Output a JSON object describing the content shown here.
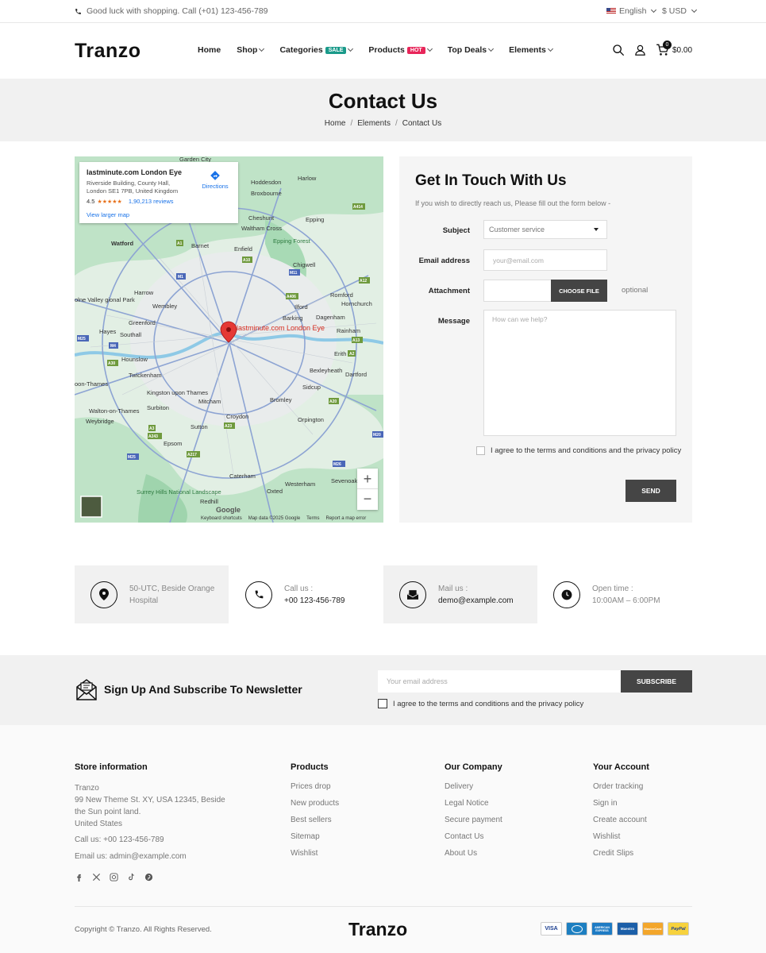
{
  "topbar": {
    "phone_text": "Good luck with shopping. Call (+01) 123-456-789",
    "language": "English",
    "currency": "$ USD"
  },
  "header": {
    "logo": "Tranzo",
    "nav": [
      {
        "label": "Home"
      },
      {
        "label": "Shop"
      },
      {
        "label": "Categories",
        "badge": "SALE",
        "badge_color": "#1a9a8a"
      },
      {
        "label": "Products",
        "badge": "HOT",
        "badge_color": "#e8265a"
      },
      {
        "label": "Top Deals"
      },
      {
        "label": "Elements"
      }
    ],
    "cart_count": "0",
    "cart_total": "$0.00"
  },
  "page": {
    "title": "Contact Us",
    "breadcrumb": [
      "Home",
      "Elements",
      "Contact Us"
    ]
  },
  "map": {
    "place_name": "lastminute.com London Eye",
    "address": "Riverside Building, County Hall, London SE1 7PB, United Kingdom",
    "rating": "4.5",
    "reviews": "1,90,213 reviews",
    "directions": "Directions",
    "larger_map": "View larger map",
    "pin_label": "lastminute.com London Eye",
    "labels": {
      "garden_city": "Garden City",
      "harlow": "Harlow",
      "hoddesdon": "Hoddesdon",
      "broxbourne": "Broxbourne",
      "cheshunt": "Cheshunt",
      "waltham": "Waltham Cross",
      "epping": "Epping",
      "epping_forest": "Epping Forest",
      "watford": "Watford",
      "barnet": "Barnet",
      "enfield": "Enfield",
      "chigwell": "Chigwell",
      "harrow": "Harrow",
      "wembley": "Wembley",
      "romford": "Romford",
      "hornchurch": "Hornchurch",
      "ilford": "Ilford",
      "barking": "Barking",
      "dagenham": "Dagenham",
      "greenford": "Greenford",
      "hayes": "Hayes",
      "southall": "Southall",
      "rainham": "Rainham",
      "erith": "Erith",
      "hounslow": "Hounslow",
      "twickenham": "Twickenham",
      "bexleyheath": "Bexleyheath",
      "dartford": "Dartford",
      "kingston": "Kingston upon Thames",
      "surbiton": "Surbiton",
      "walton": "Walton-on-Thames",
      "mitcham": "Mitcham",
      "bromley": "Bromley",
      "sidcup": "Sidcup",
      "weybridge": "Weybridge",
      "croydon": "Croydon",
      "orpington": "Orpington",
      "sutton": "Sutton",
      "epsom": "Epsom",
      "caterham": "Caterham",
      "westerham": "Westerham",
      "sevenoaks": "Sevenoak",
      "surrey": "Surrey Hills National Landscape",
      "redhill": "Redhill",
      "oxted": "Oxted",
      "colne": "olne Valley gional Park",
      "oon": "oon-Thames"
    },
    "road_badges": [
      "A414",
      "A1",
      "A10",
      "M11",
      "A12",
      "M1",
      "A406",
      "A13",
      "M25",
      "M4",
      "A30",
      "A2",
      "A20",
      "A3",
      "A243",
      "A217",
      "A23",
      "M26",
      "M20",
      "M25"
    ],
    "footer_links": [
      "Keyboard shortcuts",
      "Map data ©2025 Google",
      "Terms",
      "Report a map error"
    ],
    "google": "Google"
  },
  "form": {
    "title": "Get In Touch With Us",
    "subtitle": "If you wish to directly reach us, Please fill out the form below -",
    "subject_label": "Subject",
    "subject_value": "Customer service",
    "email_label": "Email address",
    "email_placeholder": "your@email.com",
    "attachment_label": "Attachment",
    "choose_file": "CHOOSE FILE",
    "optional": "optional",
    "message_label": "Message",
    "message_placeholder": "How can we help?",
    "agree": "I agree to the terms and conditions and the privacy policy",
    "send": "SEND"
  },
  "info": [
    {
      "label": "50-UTC, Beside Orange Hospital",
      "value": ""
    },
    {
      "label": "Call us :",
      "value": "+00 123-456-789"
    },
    {
      "label": "Mail us :",
      "value": "demo@example.com"
    },
    {
      "label": "Open time :",
      "value": "10:00AM – 6:00PM"
    }
  ],
  "newsletter": {
    "title": "Sign Up And Subscribe To Newsletter",
    "placeholder": "Your email address",
    "button": "SUBSCRIBE",
    "agree": "I agree to the terms and conditions and the privacy policy"
  },
  "footer": {
    "store_heading": "Store information",
    "store_name": "Tranzo",
    "store_address": "99 New Theme St. XY, USA 12345, Beside the Sun point land.",
    "store_country": "United States",
    "store_call": "Call us: +00 123-456-789",
    "store_email": "Email us: admin@example.com",
    "products_heading": "Products",
    "products": [
      "Prices drop",
      "New products",
      "Best sellers",
      "Sitemap",
      "Wishlist"
    ],
    "company_heading": "Our Company",
    "company": [
      "Delivery",
      "Legal Notice",
      "Secure payment",
      "Contact Us",
      "About Us"
    ],
    "account_heading": "Your Account",
    "account": [
      "Order tracking",
      "Sign in",
      "Create account",
      "Wishlist",
      "Credit Slips"
    ],
    "copyright": "Copyright © Tranzo. All Rights Reserved.",
    "logo": "Tranzo",
    "payments": [
      "VISA",
      "",
      "AMERICAN EXPRESS",
      "Maestro",
      "MasterCard",
      "PayPal"
    ]
  }
}
